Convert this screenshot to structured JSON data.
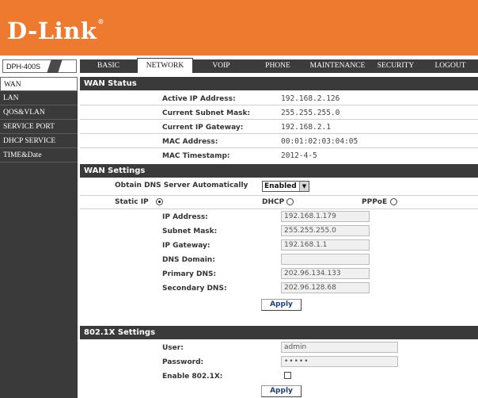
{
  "brand": {
    "logo_text": "D-Link",
    "trademark": "®"
  },
  "model": "DPH-400S",
  "nav": {
    "tabs": [
      "BASIC",
      "NETWORK",
      "VOIP",
      "PHONE",
      "MAINTENANCE",
      "SECURITY",
      "LOGOUT"
    ],
    "active": "NETWORK"
  },
  "sidebar": {
    "items": [
      "WAN",
      "LAN",
      "QOS&VLAN",
      "SERVICE PORT",
      "DHCP SERVICE",
      "TIME&Date"
    ],
    "active": "WAN"
  },
  "wan_status": {
    "title": "WAN Status",
    "rows": [
      {
        "label": "Active IP Address:",
        "value": "192.168.2.126"
      },
      {
        "label": "Current Subnet Mask:",
        "value": "255.255.255.0"
      },
      {
        "label": "Current IP Gateway:",
        "value": "192.168.2.1"
      },
      {
        "label": "MAC Address:",
        "value": "00:01:02:03:04:05"
      },
      {
        "label": "MAC Timestamp:",
        "value": "2012-4-5"
      }
    ]
  },
  "wan_settings": {
    "title": "WAN Settings",
    "dns_auto_label": "Obtain DNS Server Automatically",
    "dns_auto_value": "Enabled",
    "modes": [
      {
        "label": "Static IP",
        "checked": true
      },
      {
        "label": "DHCP",
        "checked": false
      },
      {
        "label": "PPPoE",
        "checked": false
      }
    ],
    "fields": [
      {
        "label": "IP Address:",
        "value": "192.168.1.179"
      },
      {
        "label": "Subnet Mask:",
        "value": "255.255.255.0"
      },
      {
        "label": "IP Gateway:",
        "value": "192.168.1.1"
      },
      {
        "label": "DNS Domain:",
        "value": ""
      },
      {
        "label": "Primary DNS:",
        "value": "202.96.134.133"
      },
      {
        "label": "Secondary DNS:",
        "value": "202.96.128.68"
      }
    ],
    "apply_label": "Apply"
  },
  "dot1x": {
    "title": "802.1X Settings",
    "user_label": "User:",
    "user_value": "admin",
    "password_label": "Password:",
    "password_value": "•••••",
    "enable_label": "Enable 802.1X:",
    "enable_checked": false,
    "apply_label": "Apply"
  },
  "colors": {
    "header_orange": "#ee7a30",
    "dark_gray": "#3a3a3a",
    "button_text": "#1f3e7c"
  }
}
